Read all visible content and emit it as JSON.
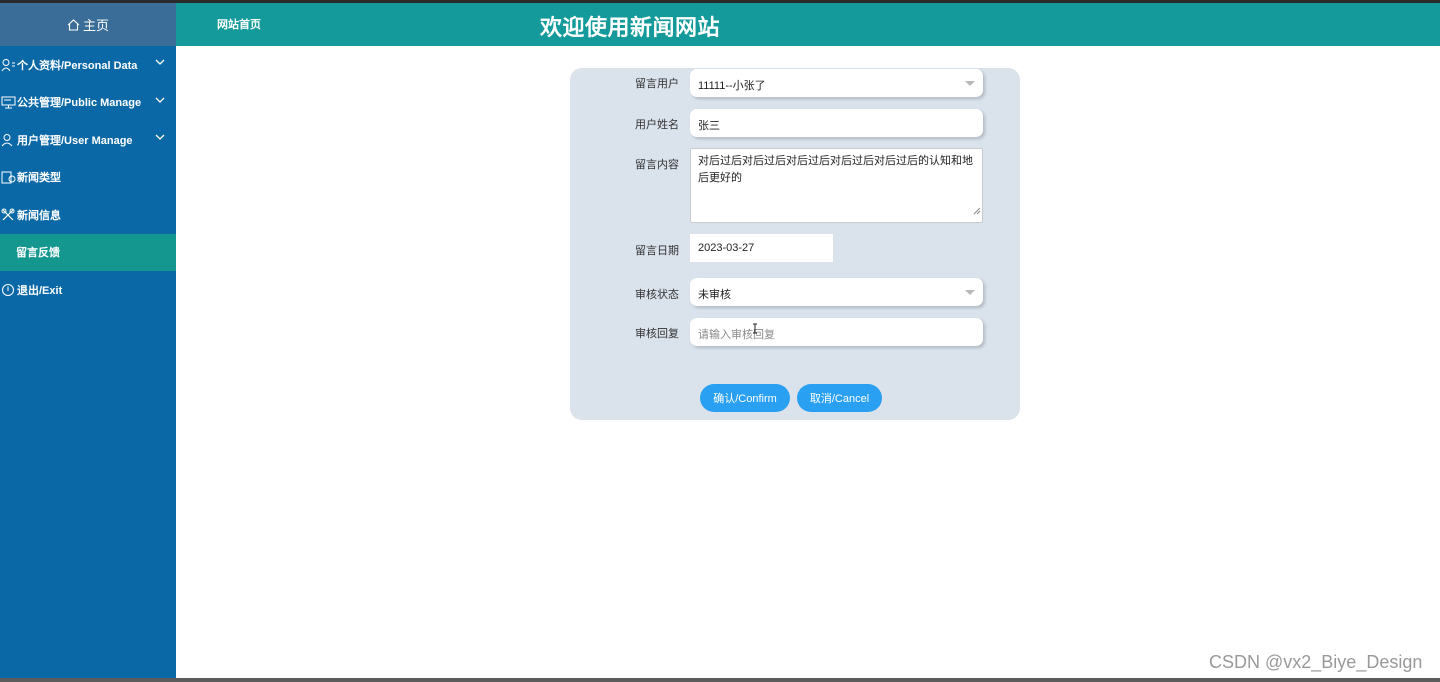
{
  "sidebar": {
    "home_label": "主页",
    "items": [
      {
        "label": "个人资料/Personal Data",
        "icon": "user-group-icon",
        "expandable": true
      },
      {
        "label": "公共管理/Public Manage",
        "icon": "monitor-icon",
        "expandable": true
      },
      {
        "label": "用户管理/User Manage",
        "icon": "user-icon",
        "expandable": true
      },
      {
        "label": "新闻类型",
        "icon": "news-type-icon",
        "expandable": false
      },
      {
        "label": "新闻信息",
        "icon": "news-info-icon",
        "expandable": false
      },
      {
        "label": "留言反馈",
        "icon": "",
        "expandable": false,
        "active": true
      },
      {
        "label": "退出/Exit",
        "icon": "exit-icon",
        "expandable": false
      }
    ]
  },
  "header": {
    "home_link": "网站首页",
    "title": "欢迎使用新闻网站"
  },
  "form": {
    "user_label": "留言用户",
    "user_value": "11111--小张了",
    "name_label": "用户姓名",
    "name_value": "张三",
    "content_label": "留言内容",
    "content_value": "对后过后对后过后对后过后对后过后对后过后的认知和地后更好的",
    "date_label": "留言日期",
    "date_value": "2023-03-27",
    "status_label": "审核状态",
    "status_value": "未审核",
    "reply_label": "审核回复",
    "reply_placeholder": "请输入审核回复",
    "confirm_label": "确认/Confirm",
    "cancel_label": "取消/Cancel"
  },
  "watermark": "CSDN @vx2_Biye_Design",
  "colors": {
    "sidebar": "#0b68a6",
    "sidebar_home": "#3a6e98",
    "active_item": "#14978f",
    "header": "#149a9a",
    "form_card": "#dae2ec",
    "button": "#2aa0f2"
  }
}
